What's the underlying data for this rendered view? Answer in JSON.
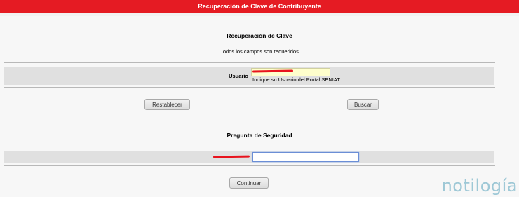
{
  "header": {
    "title": "Recuperación de Clave de Contribuyente"
  },
  "recovery": {
    "title": "Recuperación de Clave",
    "subtitle": "Todos los campos son requeridos",
    "user_label": "Usuario",
    "user_hint": "Indique su Usuario del Portal SENIAT."
  },
  "actions": {
    "reset_label": "Restablecer",
    "search_label": "Buscar"
  },
  "security": {
    "title": "Pregunta de Seguridad",
    "continue_label": "Continuar",
    "answer_value": ""
  },
  "watermark": "notilogía",
  "colors": {
    "brand_red": "#e51b23",
    "band_gray": "#e0e0e0",
    "user_field_bg": "#ffffcc"
  }
}
